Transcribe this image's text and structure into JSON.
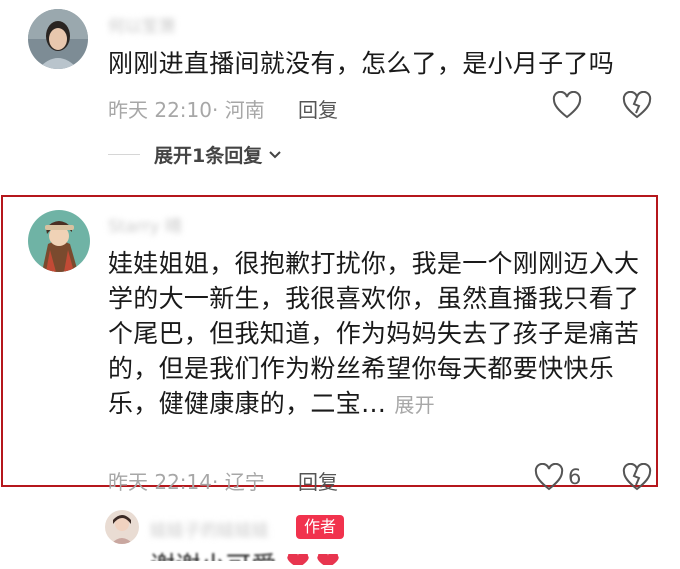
{
  "comments": [
    {
      "username": "何以笙箫",
      "text": "刚刚进直播间就没有，怎么了，是小月子了吗",
      "time": "昨天 22:10",
      "location": "· 河南",
      "reply_label": "回复",
      "expand_replies": "展开1条回复"
    },
    {
      "username": "Starry 晴",
      "text": "娃娃姐姐，很抱歉打扰你，我是一个刚刚迈入大学的大一新生，我很喜欢你，虽然直播我只看了个尾巴，但我知道，作为妈妈失去了孩子是痛苦的，但是我们作为粉丝希望你每天都要快快乐乐，健健康康的，二宝…",
      "more_label": "展开",
      "time": "昨天 22:14",
      "location": "· 辽宁",
      "reply_label": "回复",
      "like_count": "6"
    }
  ],
  "author_reply": {
    "username": "娃娃子的娃娃娃",
    "badge": "作者",
    "text": "谢谢小可爱"
  },
  "colors": {
    "highlight_border": "#b5171c",
    "badge_bg": "#f1324d",
    "heart_fill": "#e8344e"
  }
}
